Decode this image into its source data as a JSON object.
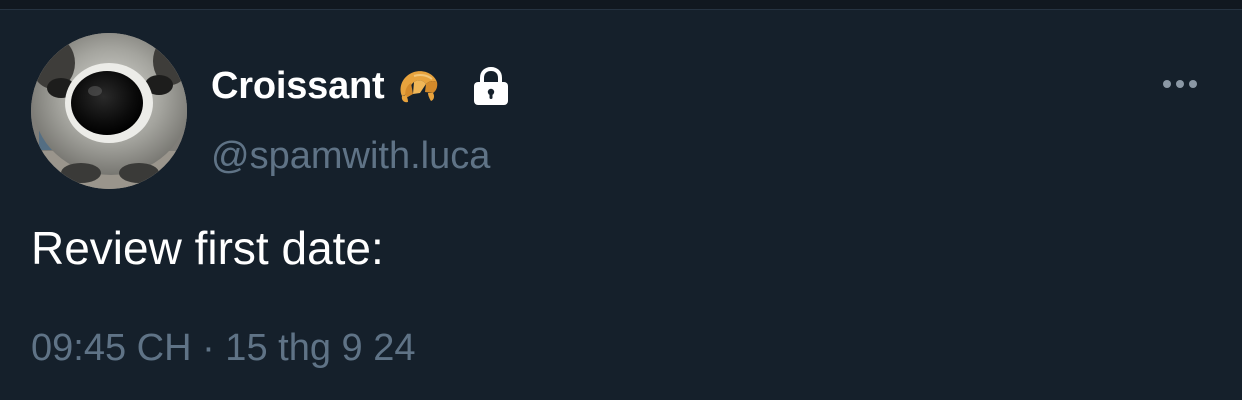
{
  "tweet": {
    "display_name": "Croissant",
    "name_emoji": "croissant-icon",
    "protected_badge": "lock-icon",
    "handle": "@spamwith.luca",
    "text": "Review first date:",
    "timestamp": "09:45 CH · 15 thg 9 24",
    "more_menu_icon": "more-options-icon",
    "avatar": "raccoon-avatar"
  },
  "colors": {
    "background": "#15202b",
    "primary_text": "#ffffff",
    "secondary_text": "#5f7386",
    "icon_gray": "#8b98a5"
  }
}
